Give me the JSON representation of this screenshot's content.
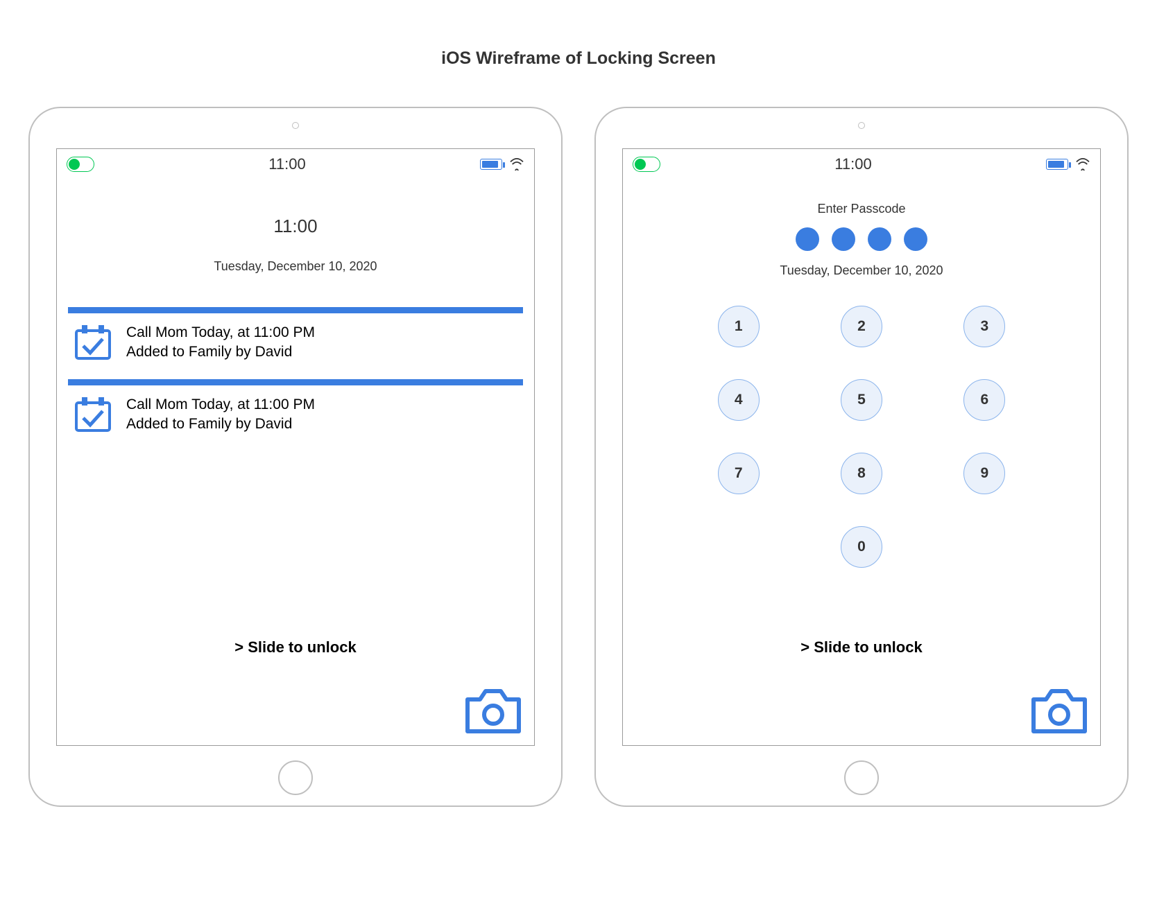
{
  "title": "iOS Wireframe of Locking Screen",
  "status_bar": {
    "time": "11:00"
  },
  "lock_screen": {
    "time": "11:00",
    "date": "Tuesday, December 10, 2020",
    "notifications": [
      {
        "line1": "Call Mom Today, at 11:00 PM",
        "line2": "Added to Family by David"
      },
      {
        "line1": "Call Mom Today, at 11:00 PM",
        "line2": "Added to Family by David"
      }
    ],
    "slide_label": "> Slide to unlock"
  },
  "passcode_screen": {
    "prompt": "Enter Passcode",
    "date": "Tuesday, December 10, 2020",
    "keys": [
      "1",
      "2",
      "3",
      "4",
      "5",
      "6",
      "7",
      "8",
      "9",
      "0"
    ],
    "slide_label": "> Slide to unlock"
  }
}
